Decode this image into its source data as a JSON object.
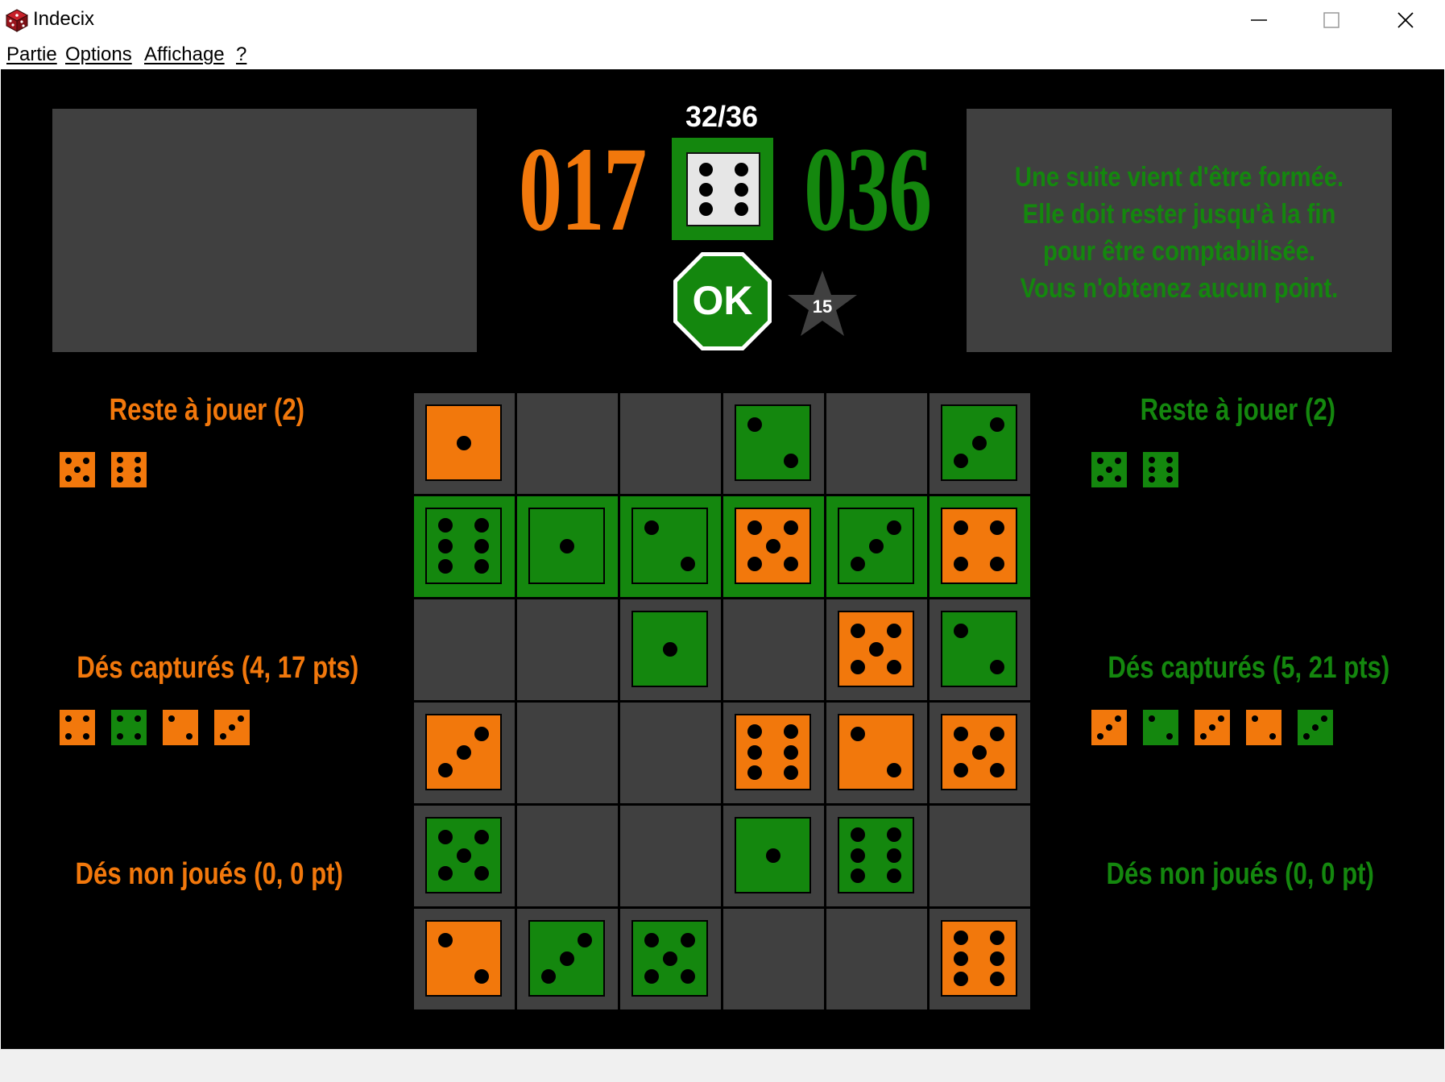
{
  "window": {
    "title": "Indecix",
    "minimize": "—",
    "maximize": "☐",
    "close": "✕"
  },
  "menu": [
    "Partie",
    "Options",
    "Affichage",
    "?"
  ],
  "header": {
    "turn_counter": "32/36",
    "score_orange": "017",
    "score_green": "036",
    "current_die": 6,
    "ok_label": "OK",
    "star_value": "15",
    "message_lines": [
      "Une suite vient d'être formée.",
      "Elle doit rester jusqu'à la fin",
      "pour être comptabilisée.",
      "Vous n'obtenez aucun point."
    ]
  },
  "colors": {
    "orange": "#f2780c",
    "green": "#14870e",
    "panel": "#404040",
    "background": "#000000"
  },
  "left": {
    "remaining_title": "Reste à jouer (2)",
    "remaining": [
      {
        "color": "o",
        "value": 5
      },
      {
        "color": "o",
        "value": 6
      }
    ],
    "captured_title": "Dés capturés (4, 17 pts)",
    "captured": [
      {
        "color": "o",
        "value": 4
      },
      {
        "color": "g",
        "value": 4
      },
      {
        "color": "o",
        "value": 2
      },
      {
        "color": "o",
        "value": 3
      }
    ],
    "unplayed_title": "Dés non joués (0, 0 pt)"
  },
  "right": {
    "remaining_title": "Reste à jouer (2)",
    "remaining": [
      {
        "color": "g",
        "value": 5
      },
      {
        "color": "g",
        "value": 6
      }
    ],
    "captured_title": "Dés capturés (5, 21 pts)",
    "captured": [
      {
        "color": "o",
        "value": 3
      },
      {
        "color": "g",
        "value": 2
      },
      {
        "color": "o",
        "value": 3
      },
      {
        "color": "o",
        "value": 2
      },
      {
        "color": "g",
        "value": 3
      }
    ],
    "unplayed_title": "Dés non joués (0, 0 pt)"
  },
  "board": {
    "highlighted_row": 1,
    "cells": [
      [
        {
          "color": "o",
          "value": 1
        },
        null,
        null,
        {
          "color": "g",
          "value": 2
        },
        null,
        {
          "color": "g",
          "value": 3
        }
      ],
      [
        {
          "color": "g",
          "value": 6
        },
        {
          "color": "g",
          "value": 1
        },
        {
          "color": "g",
          "value": 2
        },
        {
          "color": "o",
          "value": 5
        },
        {
          "color": "g",
          "value": 3
        },
        {
          "color": "o",
          "value": 4
        }
      ],
      [
        null,
        null,
        {
          "color": "g",
          "value": 1
        },
        null,
        {
          "color": "o",
          "value": 5
        },
        {
          "color": "g",
          "value": 2
        }
      ],
      [
        {
          "color": "o",
          "value": 3
        },
        null,
        null,
        {
          "color": "o",
          "value": 6
        },
        {
          "color": "o",
          "value": 2
        },
        {
          "color": "o",
          "value": 5
        }
      ],
      [
        {
          "color": "g",
          "value": 5
        },
        null,
        null,
        {
          "color": "g",
          "value": 1
        },
        {
          "color": "g",
          "value": 6
        },
        null
      ],
      [
        {
          "color": "o",
          "value": 2
        },
        {
          "color": "g",
          "value": 3
        },
        {
          "color": "g",
          "value": 5
        },
        null,
        null,
        {
          "color": "o",
          "value": 6
        }
      ]
    ]
  }
}
